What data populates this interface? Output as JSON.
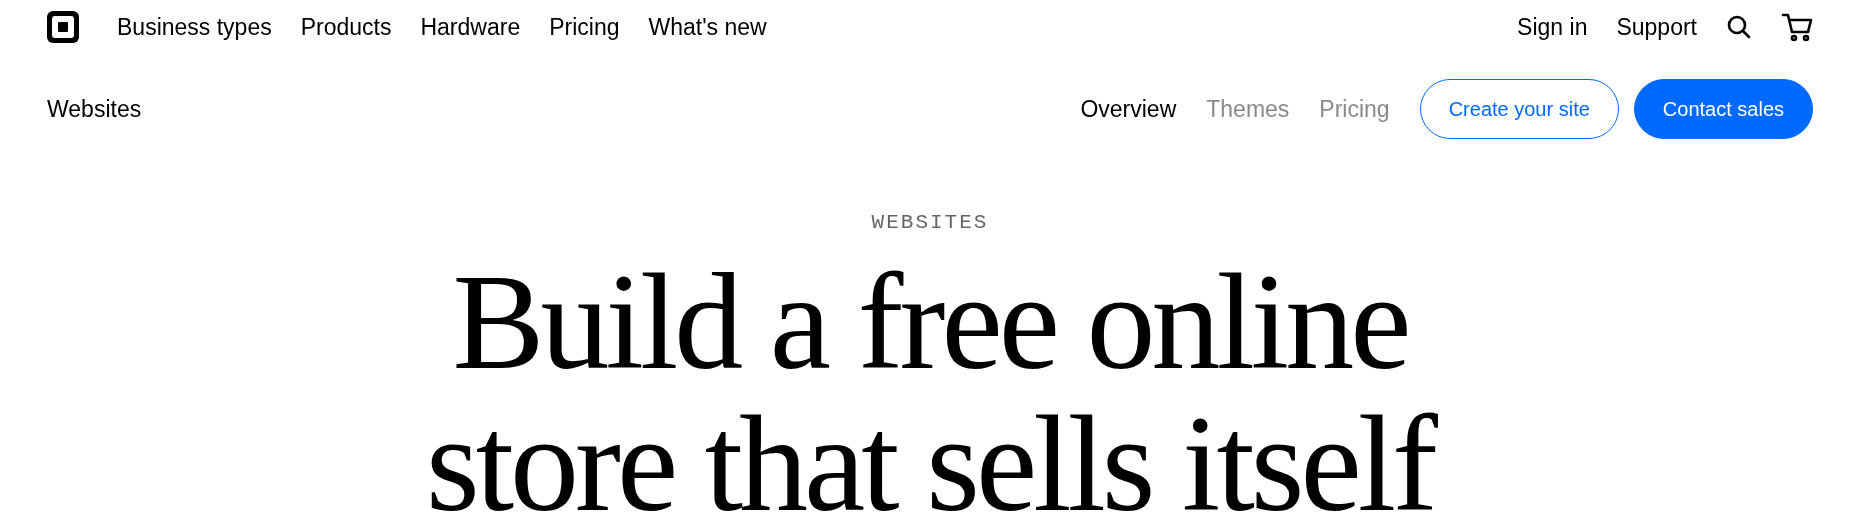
{
  "top_nav": {
    "items": [
      "Business types",
      "Products",
      "Hardware",
      "Pricing",
      "What's new"
    ],
    "right_items": [
      "Sign in",
      "Support"
    ]
  },
  "sub_nav": {
    "title": "Websites",
    "links": [
      {
        "label": "Overview",
        "selected": true
      },
      {
        "label": "Themes",
        "selected": false
      },
      {
        "label": "Pricing",
        "selected": false
      }
    ],
    "buttons": [
      {
        "label": "Create your site",
        "kind": "outline"
      },
      {
        "label": "Contact sales",
        "kind": "filled"
      }
    ]
  },
  "hero": {
    "eyebrow": "WEBSITES",
    "headline_lines": [
      "Build a free online",
      "store that sells itself"
    ]
  }
}
